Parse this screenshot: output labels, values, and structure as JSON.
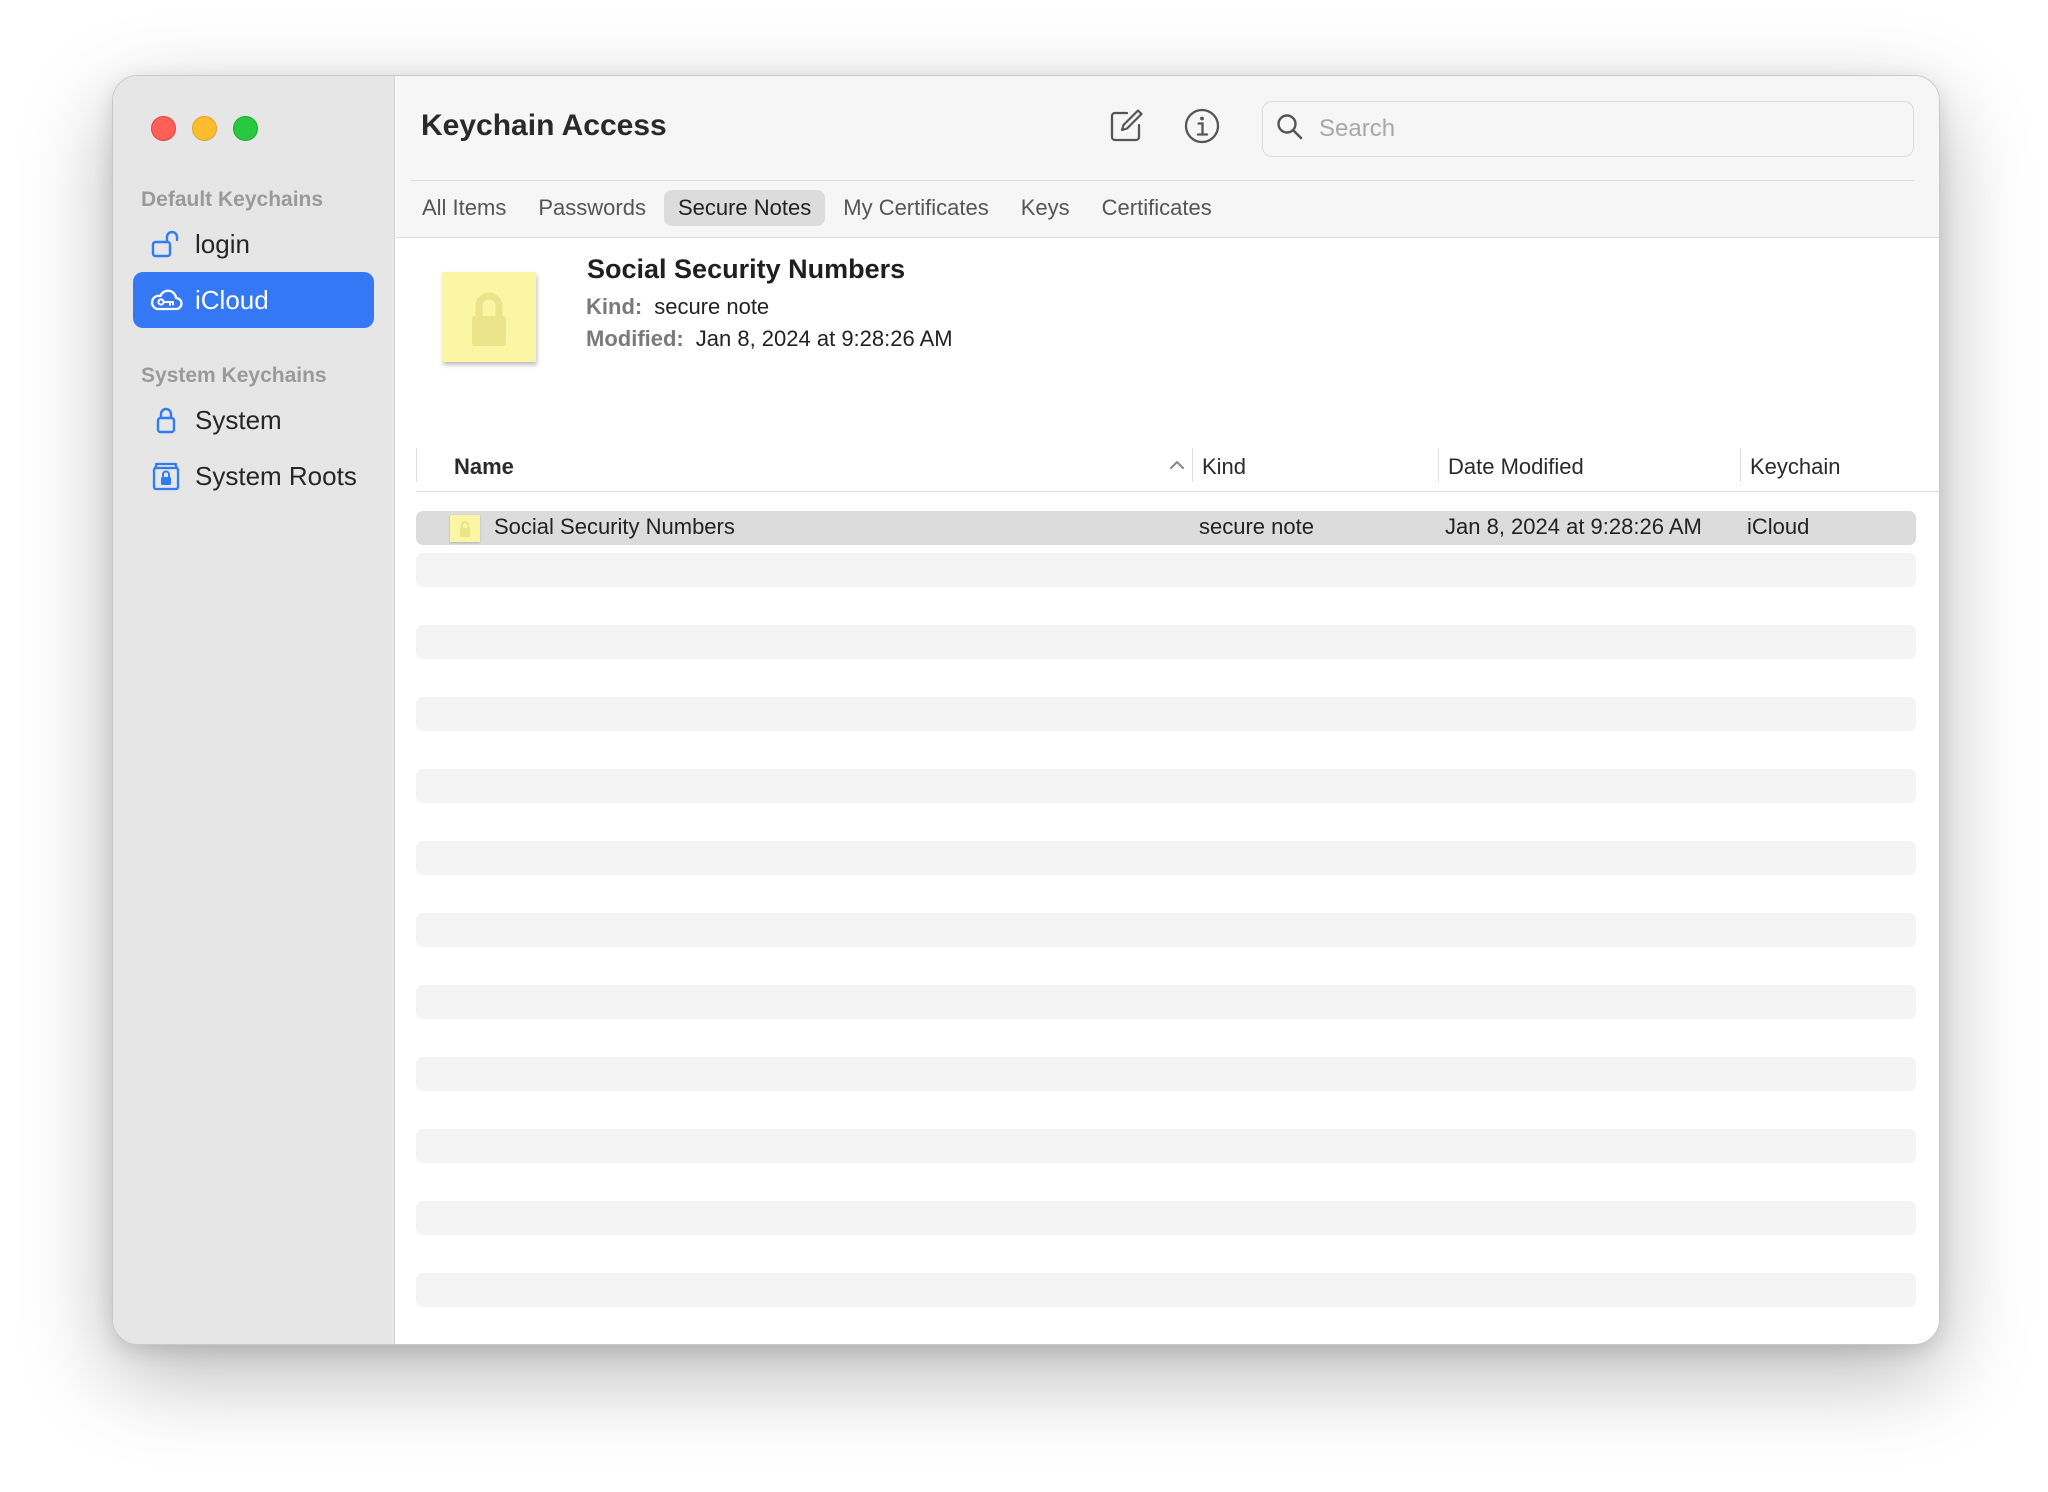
{
  "window": {
    "title": "Keychain Access"
  },
  "sidebar": {
    "sections": [
      {
        "title": "Default Keychains",
        "items": [
          {
            "label": "login",
            "icon": "unlocked-padlock-icon",
            "selected": false
          },
          {
            "label": "iCloud",
            "icon": "cloud-key-icon",
            "selected": true
          }
        ]
      },
      {
        "title": "System Keychains",
        "items": [
          {
            "label": "System",
            "icon": "padlock-icon",
            "selected": false
          },
          {
            "label": "System Roots",
            "icon": "cabinet-lock-icon",
            "selected": false
          }
        ]
      }
    ]
  },
  "toolbar": {
    "compose_icon": "compose-icon",
    "info_icon": "info-icon",
    "search": {
      "placeholder": "Search",
      "value": ""
    }
  },
  "tabs": [
    {
      "label": "All Items",
      "active": false
    },
    {
      "label": "Passwords",
      "active": false
    },
    {
      "label": "Secure Notes",
      "active": true
    },
    {
      "label": "My Certificates",
      "active": false
    },
    {
      "label": "Keys",
      "active": false
    },
    {
      "label": "Certificates",
      "active": false
    }
  ],
  "detail": {
    "title": "Social Security Numbers",
    "kind_label": "Kind:",
    "kind_value": "secure note",
    "modified_label": "Modified:",
    "modified_value": "Jan 8, 2024 at 9:28:26 AM",
    "icon": "secure-note-icon"
  },
  "table": {
    "columns": [
      "Name",
      "Kind",
      "Date Modified",
      "Keychain"
    ],
    "sort": {
      "column": "Name",
      "direction": "ascending"
    },
    "rows": [
      {
        "name": "Social Security Numbers",
        "kind": "secure note",
        "date_modified": "Jan 8, 2024 at 9:28:26 AM",
        "keychain": "iCloud",
        "selected": true
      }
    ]
  },
  "colors": {
    "accent": "#3478f6",
    "note_yellow": "#fbf6a4",
    "sidebar_bg": "#e6e6e6"
  }
}
